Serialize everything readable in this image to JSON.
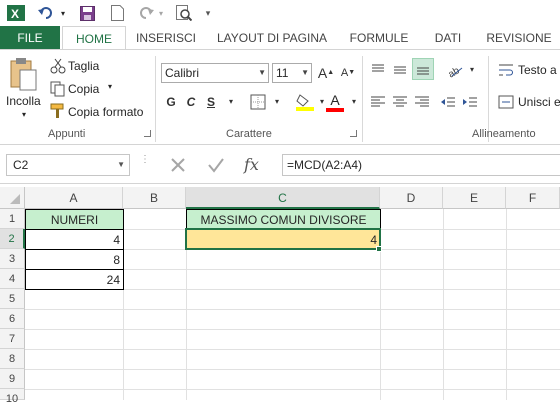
{
  "qat": {
    "icons": [
      "excel-logo-icon",
      "undo-icon",
      "save-icon",
      "new-file-icon",
      "redo-icon",
      "print-preview-icon",
      "customize-icon"
    ]
  },
  "tabs": [
    "FILE",
    "HOME",
    "INSERISCI",
    "LAYOUT DI PAGINA",
    "FORMULE",
    "DATI",
    "REVISIONE"
  ],
  "ribbon": {
    "clipboard": {
      "paste_label": "Incolla",
      "cut_label": "Taglia",
      "copy_label": "Copia",
      "format_painter_label": "Copia formato",
      "group_label": "Appunti"
    },
    "font": {
      "font_name": "Calibri",
      "font_size": "11",
      "bold": "G",
      "italic": "C",
      "underline": "S",
      "grow": "A",
      "shrink": "A",
      "font_color_letter": "A",
      "group_label": "Carattere",
      "fill_color": "#ffff00",
      "font_color": "#ff0000"
    },
    "alignment": {
      "wrap_label": "Testo a",
      "merge_label": "Unisci e",
      "group_label": "Allineamento"
    }
  },
  "formula_bar": {
    "name_box": "C2",
    "fx": "fx",
    "formula": "=MCD(A2:A4)"
  },
  "grid": {
    "columns": [
      "A",
      "B",
      "C",
      "D",
      "E",
      "F"
    ],
    "rows": [
      "1",
      "2",
      "3",
      "4",
      "5",
      "6",
      "7",
      "8",
      "9",
      "10"
    ],
    "cells": {
      "A1": "NUMERI",
      "A2": "4",
      "A3": "8",
      "A4": "24",
      "C1": "MASSIMO COMUN DIVISORE",
      "C2": "4"
    },
    "active_cell": "C2",
    "header_fill": "#c6efce",
    "result_fill": "#ffe699",
    "accent": "#217346"
  }
}
